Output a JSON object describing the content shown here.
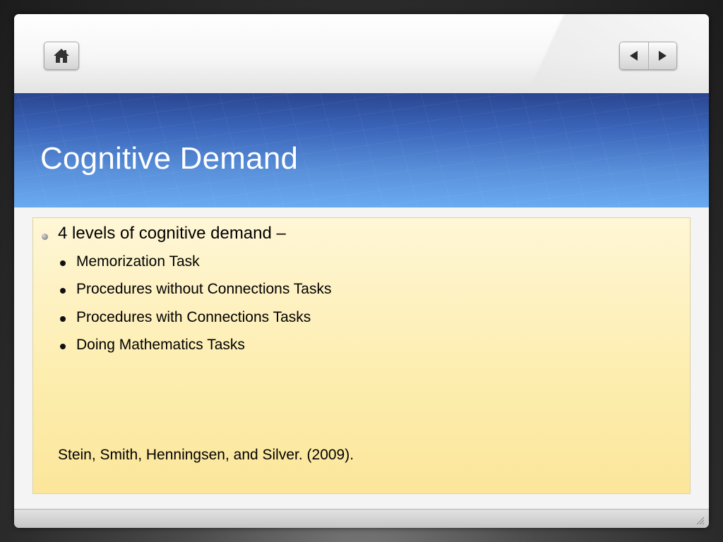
{
  "toolbar": {
    "home_icon": "home-icon",
    "prev_icon": "arrow-left-icon",
    "next_icon": "arrow-right-icon"
  },
  "slide": {
    "title": "Cognitive Demand",
    "main_bullet": "4 levels of cognitive demand –",
    "sub_bullets": [
      "Memorization Task",
      "Procedures without Connections Tasks",
      "Procedures with Connections Tasks",
      "Doing Mathematics Tasks"
    ],
    "citation": "Stein, Smith, Henningsen, and Silver. (2009)."
  },
  "colors": {
    "title_band_top": "#2a4590",
    "title_band_bottom": "#6aaaf0",
    "content_bg": "#fdeeb0",
    "title_text": "#ffffff"
  }
}
